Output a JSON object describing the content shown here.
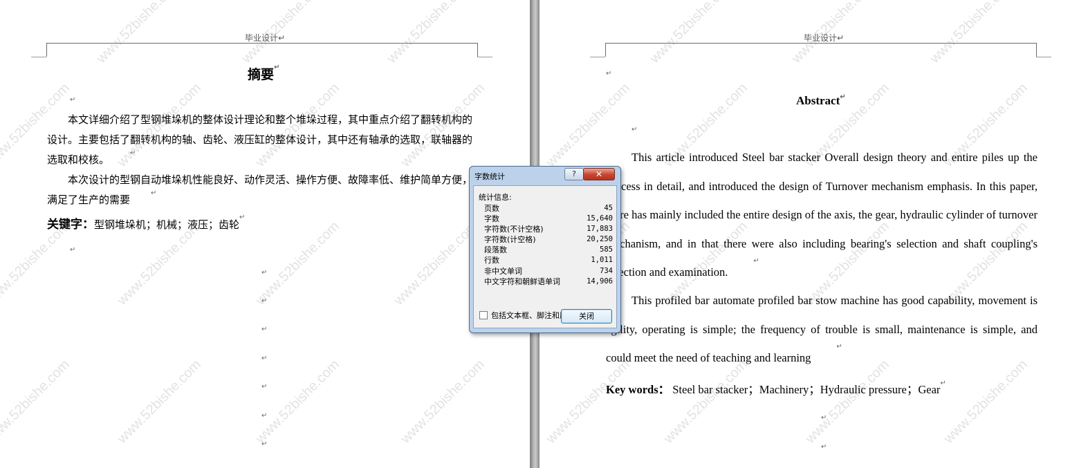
{
  "header_text": "毕业设计",
  "paragraph_mark": "↵",
  "watermark": "www.52bishe.com",
  "left_page": {
    "title": "摘要",
    "paragraphs": [
      "本文详细介绍了型钢堆垛机的整体设计理论和整个堆垛过程，其中重点介绍了翻转机构的设计。主要包括了翻转机构的轴、齿轮、液压缸的整体设计，其中还有轴承的选取，联轴器的选取和校核。",
      "本次设计的型钢自动堆垛机性能良好、动作灵活、操作方便、故障率低、维护简单方便，满足了生产的需要"
    ],
    "keywords_label": "关键字：",
    "keywords": "型钢堆垛机；机械；液压；齿轮"
  },
  "right_page": {
    "title": "Abstract",
    "paragraphs": [
      "This article introduced Steel bar stacker Overall design theory and entire piles up the process in detail, and introduced the design of Turnover mechanism emphasis. In this paper, there has mainly included the entire design of the axis, the gear, hydraulic cylinder of turnover mechanism, and in that there were also including bearing's selection and shaft coupling's selection and examination.",
      "This profiled bar automate profiled bar stow machine has good capability, movement is agility, operating is simple; the frequency of trouble is small, maintenance is simple, and could meet the need of teaching and learning"
    ],
    "keywords_label": "Key words：",
    "keywords": "Steel bar stacker；Machinery；Hydraulic pressure；Gear"
  },
  "dialog": {
    "title": "字数统计",
    "help_label": "?",
    "close_x_label": "✕",
    "group_label": "统计信息:",
    "stats": [
      {
        "label": "页数",
        "value": "45"
      },
      {
        "label": "字数",
        "value": "15,640"
      },
      {
        "label": "字符数(不计空格)",
        "value": "17,883"
      },
      {
        "label": "字符数(计空格)",
        "value": "20,250"
      },
      {
        "label": "段落数",
        "value": "585"
      },
      {
        "label": "行数",
        "value": "1,011"
      },
      {
        "label": "非中文单词",
        "value": "734"
      },
      {
        "label": "中文字符和朝鲜语单词",
        "value": "14,906"
      }
    ],
    "checkbox_label": "包括文本框、脚注和尾注(F)",
    "close_button_label": "关闭"
  }
}
